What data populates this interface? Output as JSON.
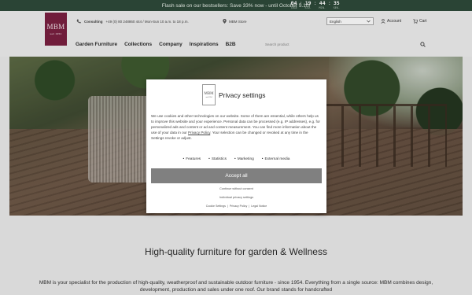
{
  "topbar": {
    "message": "Flash sale on our bestsellers: Save 33% now - until October 5.10!",
    "countdown": [
      {
        "value": "04",
        "label": "TAGE"
      },
      {
        "value": "19",
        "label": "STD."
      },
      {
        "value": "44",
        "label": "MIN."
      },
      {
        "value": "35",
        "label": "SEK."
      }
    ],
    "bg_color": "#2e4a3a"
  },
  "header": {
    "logo": {
      "text": "MBM",
      "subtext": "seit 1954",
      "color": "#7a2040"
    },
    "contact": {
      "label": "Consulting",
      "phone": "+49 (0) 80 248860 444 / Mon-Sun 10 a.m. to 18 p.m."
    },
    "store": "MBM Store",
    "language": "English",
    "account": "Account",
    "cart": "Cart",
    "nav": [
      "Garden Furniture",
      "Collections",
      "Company",
      "Inspirations",
      "B2B"
    ],
    "search_placeholder": "Search product"
  },
  "modal": {
    "logo_text": "MBM",
    "logo_subtext": "seit 1954",
    "title": "Privacy settings",
    "body_before_link": "We use cookies and other technologies on our website. Some of them are essential, while others help us to improve this website and your experience. Personal data can be processed (e.g. IP addresses), e.g. for personalized ads and content or ad and content measurement. You can find more information about the use of your data in our ",
    "body_link": "Privacy Policy",
    "body_after_link": ". Your selection can be changed or revoked at any time in the Settings revoke or adjust.",
    "options": [
      "Features",
      "Statistics",
      "Marketing",
      "External media"
    ],
    "accept_label": "Accept all",
    "continue_label": "Continue without consent",
    "individual_label": "Individual privacy settings",
    "footer_links": [
      "Cookie Settings",
      "Privacy Policy",
      "Legal Notice"
    ]
  },
  "content": {
    "headline": "High-quality furniture for garden & Wellness",
    "paragraph": "MBM is your specialist for the production of high-quality, weatherproof and sustainable outdoor furniture - since 1954. Everything from a single source: MBM combines design, development, production and sales under one roof. Our brand stands for handcrafted"
  }
}
